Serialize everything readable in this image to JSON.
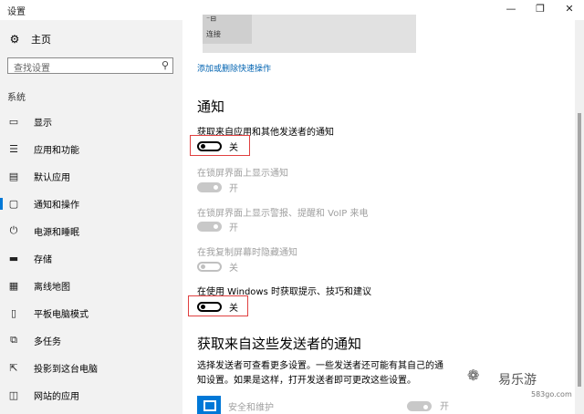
{
  "window": {
    "title": "设置",
    "controls": [
      "—",
      "❐",
      "✕"
    ]
  },
  "sidebar": {
    "home_label": "主页",
    "search_placeholder": "查找设置",
    "group_label": "系统",
    "items": [
      {
        "label": "显示",
        "icon": "display-icon"
      },
      {
        "label": "应用和功能",
        "icon": "apps-list-icon"
      },
      {
        "label": "默认应用",
        "icon": "default-apps-icon"
      },
      {
        "label": "通知和操作",
        "icon": "notification-icon",
        "active": true
      },
      {
        "label": "电源和睡眠",
        "icon": "power-icon"
      },
      {
        "label": "存储",
        "icon": "storage-icon"
      },
      {
        "label": "离线地图",
        "icon": "map-icon"
      },
      {
        "label": "平板电脑模式",
        "icon": "tablet-icon"
      },
      {
        "label": "多任务",
        "icon": "multitask-icon"
      },
      {
        "label": "投影到这台电脑",
        "icon": "project-icon"
      },
      {
        "label": "网站的应用",
        "icon": "web-apps-icon"
      }
    ]
  },
  "quick_actions": {
    "tile_line1": "⁻⊟",
    "tile_line2": "连接",
    "link": "添加或删除快速操作"
  },
  "notifications": {
    "heading": "通知",
    "settings": [
      {
        "label": "获取来自应用和其他发送者的通知",
        "state": "关",
        "on": false,
        "disabled": false
      },
      {
        "label": "在锁屏界面上显示通知",
        "state": "开",
        "on": true,
        "disabled": true
      },
      {
        "label": "在锁屏界面上显示警报、提醒和 VoIP 来电",
        "state": "开",
        "on": true,
        "disabled": true
      },
      {
        "label": "在我复制屏幕时隐藏通知",
        "state": "关",
        "on": false,
        "disabled": true
      },
      {
        "label": "在使用 Windows 时获取提示、技巧和建议",
        "state": "关",
        "on": false,
        "disabled": false
      }
    ]
  },
  "senders": {
    "heading": "获取来自这些发送者的通知",
    "description": "选择发送者可查看更多设置。一些发送者还可能有其自己的通知设置。如果是这样，打开发送者即可更改这些设置。",
    "apps": [
      {
        "name": "安全和维护",
        "state": "开",
        "on": true,
        "disabled": true
      }
    ]
  },
  "watermark": {
    "icon": "wechat-icon",
    "brand": "易乐游",
    "site": "583go.com"
  },
  "colors": {
    "accent": "#0078d7",
    "link": "#0063b1",
    "highlight_box": "#e04040"
  }
}
